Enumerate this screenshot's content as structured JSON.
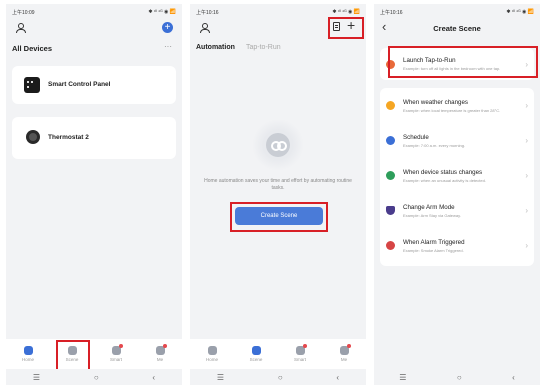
{
  "phone1": {
    "status_time": "上午10:09",
    "status_right": "✱ ᵈᴵ ⁴ᴳ ◉ 📶",
    "title": "All Devices",
    "more": "···",
    "devices": [
      {
        "name": "Smart Control Panel"
      },
      {
        "name": "Thermostat 2"
      }
    ],
    "tabs": [
      {
        "label": "Home"
      },
      {
        "label": "Scene"
      },
      {
        "label": "Smart"
      },
      {
        "label": "Me"
      }
    ]
  },
  "phone2": {
    "status_time": "上午10:16",
    "status_right": "✱ ᵈᴵ ⁴ᴳ ◉ 📶",
    "tab_automation": "Automation",
    "tab_tap_to_run": "Tap-to-Run",
    "plus": "+",
    "empty_text": "Home automation saves your time and effort by automating routine tasks.",
    "create_scene_button": "Create Scene",
    "tabs": [
      {
        "label": "Home"
      },
      {
        "label": "Scene"
      },
      {
        "label": "Smart"
      },
      {
        "label": "Me"
      }
    ]
  },
  "phone3": {
    "status_time": "上午10:16",
    "status_right": "✱ ᵈᴵ ⁴ᴳ ◉ 📶",
    "back": "‹",
    "title": "Create Scene",
    "launch": {
      "title": "Launch Tap-to-Run",
      "desc": "Example: turn off all lights in the bedroom with one tap."
    },
    "conditions": [
      {
        "title": "When weather changes",
        "desc": "Example: when local temperature is greater than 28°C.",
        "color": "#f5a623"
      },
      {
        "title": "Schedule",
        "desc": "Example: 7:00 a.m. every morning.",
        "color": "#3b6fd6"
      },
      {
        "title": "When device status changes",
        "desc": "Example: when an unusual activity is detected.",
        "color": "#2e9e5b"
      },
      {
        "title": "Change Arm Mode",
        "desc": "Example: Arm Stay via Gateway.",
        "color": "#4a3c8c"
      },
      {
        "title": "When Alarm Triggered",
        "desc": "Example: Smoke Alarm Triggered.",
        "color": "#d64545"
      }
    ],
    "chevron": "›"
  },
  "nav": {
    "menu": "☰",
    "home": "○",
    "back": "‹"
  },
  "colors": {
    "accent": "#3b6fd6",
    "highlight": "#d81f26"
  }
}
